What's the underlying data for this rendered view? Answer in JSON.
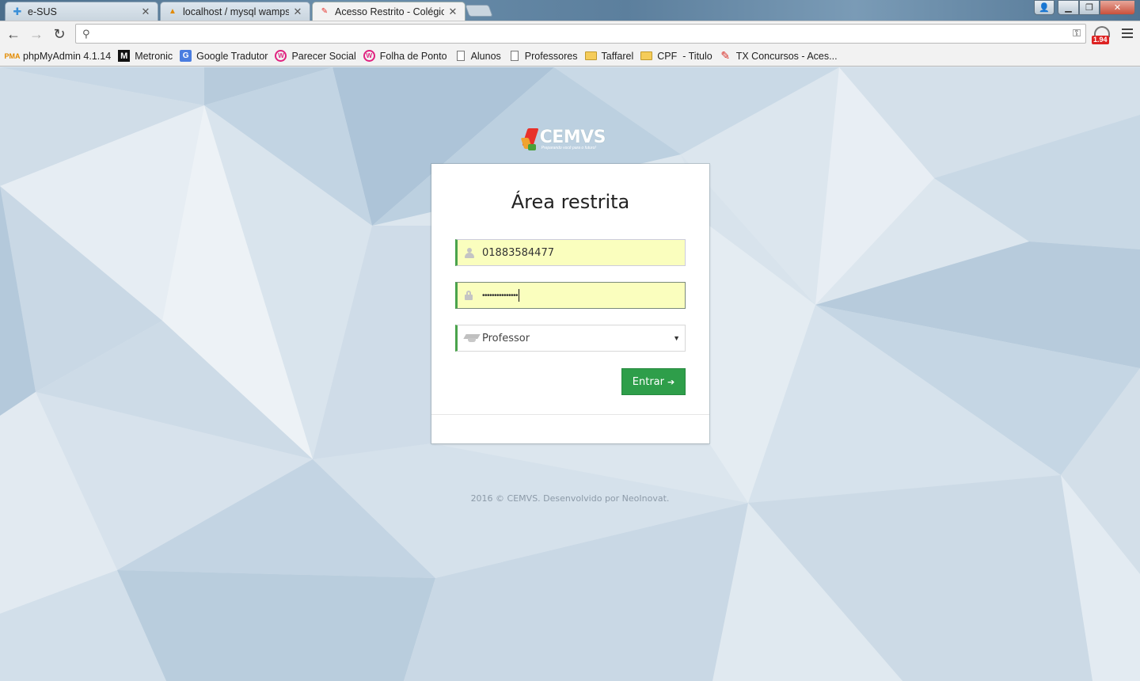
{
  "browser": {
    "tabs": [
      {
        "title": "e-SUS",
        "favicon": "puzzle-icon"
      },
      {
        "title": "localhost / mysql wampser",
        "favicon": "phpmyadmin-icon"
      },
      {
        "title": "Acesso Restrito - Colégio E",
        "favicon": "cemvs-icon",
        "active": true
      }
    ],
    "tab_close": "✕",
    "window": {
      "minimize": "▁",
      "maximize": "❐",
      "close": "✕",
      "user": "👤"
    },
    "address": "",
    "extension_badge": "1.94",
    "bookmarks": [
      {
        "label": "phpMyAdmin 4.1.14",
        "icon": "phpmyadmin-icon"
      },
      {
        "label": "Metronic",
        "icon": "metronic-icon"
      },
      {
        "label": "Google Tradutor",
        "icon": "google-translate-icon"
      },
      {
        "label": "Parecer Social",
        "icon": "folha-icon"
      },
      {
        "label": "Folha de Ponto",
        "icon": "folha-icon"
      },
      {
        "label": "Alunos",
        "icon": "page-icon"
      },
      {
        "label": "Professores",
        "icon": "page-icon"
      },
      {
        "label": "Taffarel",
        "icon": "folder-icon"
      },
      {
        "label": "CPF  - Titulo",
        "icon": "folder-icon"
      },
      {
        "label": "TX Concursos - Aces...",
        "icon": "tx-icon"
      }
    ]
  },
  "page": {
    "logo": {
      "word": "CEMVS",
      "tagline": "Preparando você para o futuro!"
    },
    "title": "Área restrita",
    "username": {
      "value": "01883584477"
    },
    "password": {
      "value": "•••••••••••••••"
    },
    "role_select": {
      "selected": "Professor",
      "arrow": "▼"
    },
    "submit_label": "Entrar",
    "submit_icon": "sign-in-icon",
    "footer": "2016 © CEMVS. Desenvolvido por NeoInovat."
  },
  "colors": {
    "accent_green": "#2e9e4a",
    "field_border": "#4aa34c",
    "autofill": "#fafebe"
  }
}
